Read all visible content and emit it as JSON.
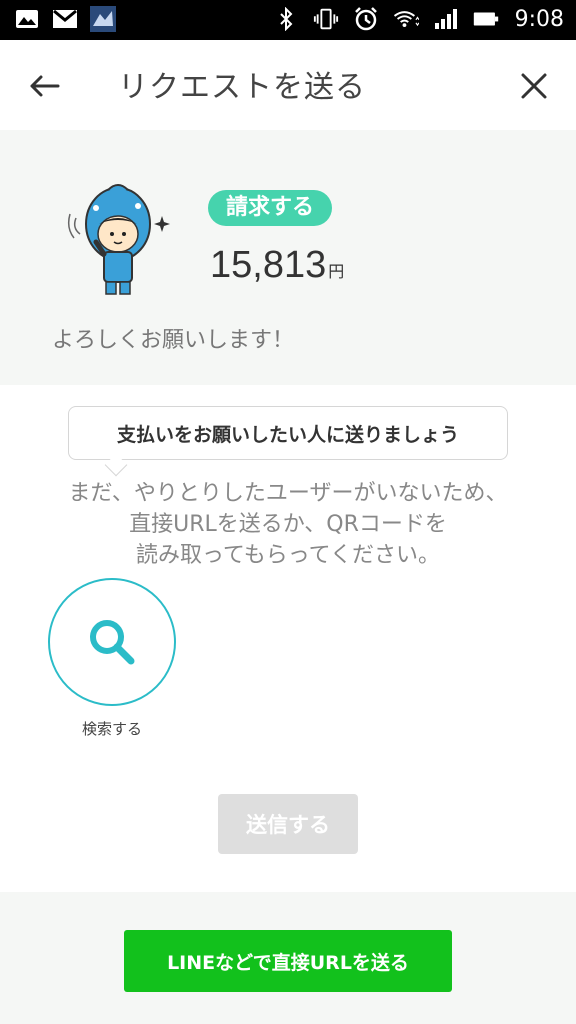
{
  "status_bar": {
    "time": "9:08",
    "left_icons": [
      "gallery-icon",
      "gmail-icon",
      "app-icon"
    ],
    "right_icons": [
      "bluetooth-icon",
      "vibrate-icon",
      "alarm-icon",
      "wifi-icon",
      "signal-icon",
      "battery-icon"
    ]
  },
  "header": {
    "title": "リクエストを送る",
    "back_icon": "arrow-left-icon",
    "close_icon": "close-icon"
  },
  "summary": {
    "badge": "請求する",
    "amount": "15,813",
    "currency": "円",
    "message": "よろしくお願いします！"
  },
  "tooltip": {
    "text": "支払いをお願いしたい人に送りましょう"
  },
  "info": {
    "line1": "まだ、やりとりしたユーザーがいないため、",
    "line2": "直接URLを送るか、QRコードを",
    "line3": "読み取ってもらってください。"
  },
  "search": {
    "label": "検索する",
    "icon": "search-icon"
  },
  "send_button": {
    "label": "送信する"
  },
  "line_button": {
    "label": "LINEなどで直接URLを送る"
  },
  "colors": {
    "badge": "#46d3ad",
    "search_ring": "#2bbcc8",
    "line_green": "#12c11c",
    "disabled": "#dedede"
  }
}
